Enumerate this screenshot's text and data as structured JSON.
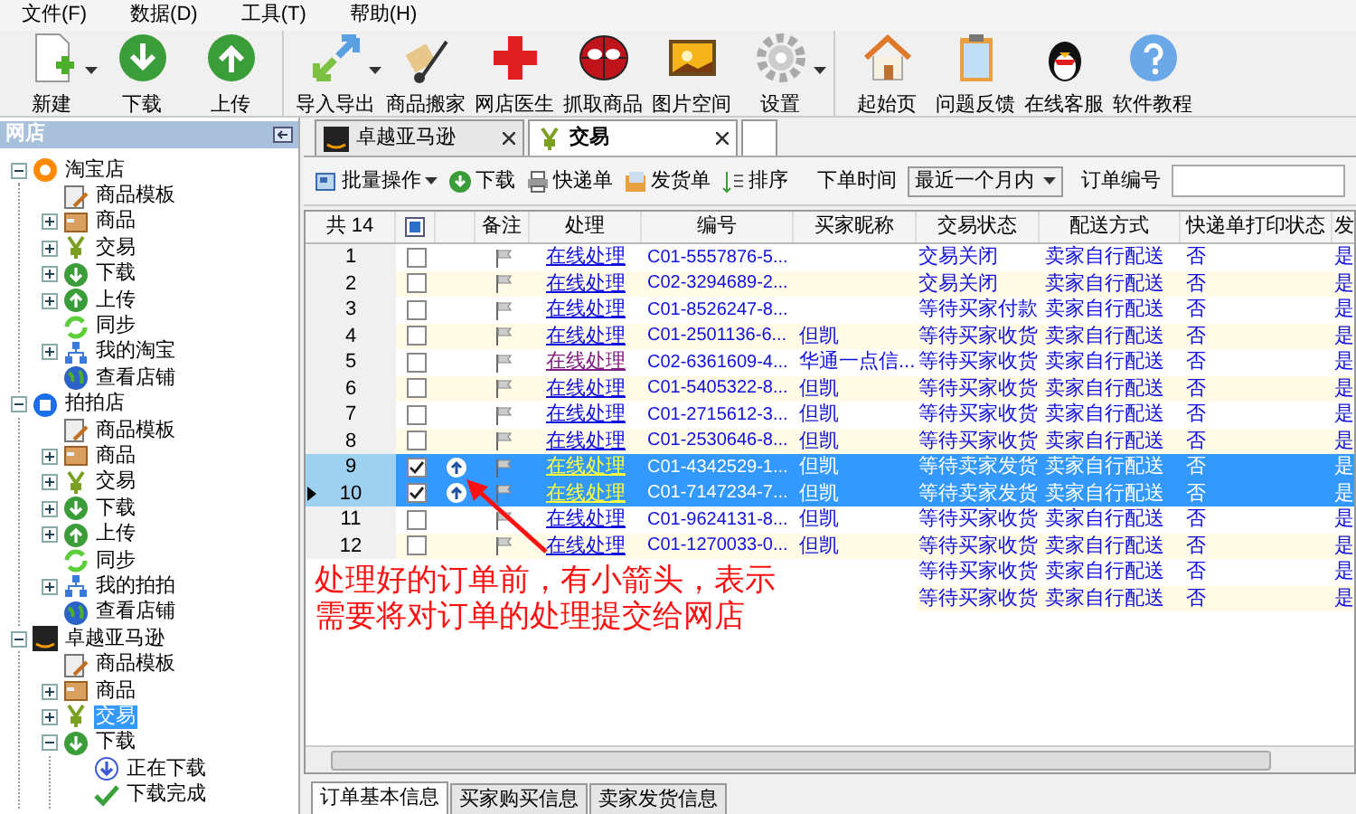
{
  "menu": [
    "文件(F)",
    "数据(D)",
    "工具(T)",
    "帮助(H)"
  ],
  "toolbar": [
    [
      {
        "label": "新建",
        "dropdown": true
      },
      {
        "label": "下载",
        "dropdown": false
      },
      {
        "label": "上传",
        "dropdown": false
      }
    ],
    [
      {
        "label": "导入导出",
        "dropdown": true
      },
      {
        "label": "商品搬家",
        "dropdown": false
      },
      {
        "label": "网店医生",
        "dropdown": false
      },
      {
        "label": "抓取商品",
        "dropdown": false
      },
      {
        "label": "图片空间",
        "dropdown": false
      },
      {
        "label": "设置",
        "dropdown": true
      }
    ],
    [
      {
        "label": "起始页",
        "dropdown": false
      },
      {
        "label": "问题反馈",
        "dropdown": false
      },
      {
        "label": "在线客服",
        "dropdown": false
      },
      {
        "label": "软件教程",
        "dropdown": false
      }
    ]
  ],
  "sidebar": {
    "title": "网店",
    "tree": [
      {
        "label": "淘宝店",
        "kind": "taobao",
        "expanded": true,
        "selected": false,
        "children": [
          {
            "label": "商品模板",
            "kind": "template",
            "selected": false
          },
          {
            "label": "商品",
            "kind": "goods",
            "expanded": false,
            "selected": false
          },
          {
            "label": "交易",
            "kind": "trade",
            "expanded": false,
            "selected": false
          },
          {
            "label": "下载",
            "kind": "download",
            "expanded": false,
            "selected": false
          },
          {
            "label": "上传",
            "kind": "upload",
            "expanded": false,
            "selected": false
          },
          {
            "label": "同步",
            "kind": "sync",
            "selected": false
          },
          {
            "label": "我的淘宝",
            "kind": "network",
            "expanded": false,
            "selected": false
          },
          {
            "label": "查看店铺",
            "kind": "globe",
            "selected": false
          }
        ]
      },
      {
        "label": "拍拍店",
        "kind": "paipai",
        "expanded": true,
        "selected": false,
        "children": [
          {
            "label": "商品模板",
            "kind": "template",
            "selected": false
          },
          {
            "label": "商品",
            "kind": "goods",
            "expanded": false,
            "selected": false
          },
          {
            "label": "交易",
            "kind": "trade",
            "expanded": false,
            "selected": false
          },
          {
            "label": "下载",
            "kind": "download",
            "expanded": false,
            "selected": false
          },
          {
            "label": "上传",
            "kind": "upload",
            "expanded": false,
            "selected": false
          },
          {
            "label": "同步",
            "kind": "sync",
            "selected": false
          },
          {
            "label": "我的拍拍",
            "kind": "network",
            "expanded": false,
            "selected": false
          },
          {
            "label": "查看店铺",
            "kind": "globe",
            "selected": false
          }
        ]
      },
      {
        "label": "卓越亚马逊",
        "kind": "amazon",
        "expanded": true,
        "selected": false,
        "children": [
          {
            "label": "商品模板",
            "kind": "template",
            "selected": false
          },
          {
            "label": "商品",
            "kind": "goods",
            "expanded": false,
            "selected": false
          },
          {
            "label": "交易",
            "kind": "trade",
            "expanded": false,
            "selected": true
          },
          {
            "label": "下载",
            "kind": "download",
            "expanded": true,
            "selected": false,
            "children": [
              {
                "label": "正在下载",
                "kind": "downloading",
                "selected": false
              },
              {
                "label": "下载完成",
                "kind": "done",
                "selected": false
              }
            ]
          }
        ]
      }
    ]
  },
  "tabs": [
    {
      "label": "卓越亚马逊",
      "selected": false
    },
    {
      "label": "交易",
      "selected": true
    }
  ],
  "filter_bar": {
    "buttons": [
      {
        "label": "批量操作",
        "dropdown": true
      },
      {
        "label": "下载",
        "dropdown": false
      },
      {
        "label": "快递单",
        "dropdown": false
      },
      {
        "label": "发货单",
        "dropdown": false
      },
      {
        "label": "排序",
        "dropdown": false
      }
    ],
    "time_label": "下单时间",
    "time_value": "最近一个月内",
    "order_label": "订单编号"
  },
  "table": {
    "count": "共 14",
    "select_all_partial": true,
    "columns": [
      "备注",
      "处理",
      "编号",
      "买家昵称",
      "交易状态",
      "配送方式",
      "快递单打印状态",
      "发"
    ],
    "rows": [
      {
        "number": "1",
        "checked": false,
        "selected": false,
        "current": false,
        "pending_upload": false,
        "visited": false,
        "handle": "在线处理",
        "order_no": "C01-5557876-5...",
        "buyer": "",
        "status": "交易关闭",
        "delivery": "卖家自行配送",
        "printed": "否",
        "column_11": "是"
      },
      {
        "number": "2",
        "checked": false,
        "selected": false,
        "current": false,
        "pending_upload": false,
        "visited": false,
        "handle": "在线处理",
        "order_no": "C02-3294689-2...",
        "buyer": "",
        "status": "交易关闭",
        "delivery": "卖家自行配送",
        "printed": "否",
        "column_11": "是"
      },
      {
        "number": "3",
        "checked": false,
        "selected": false,
        "current": false,
        "pending_upload": false,
        "visited": false,
        "handle": "在线处理",
        "order_no": "C01-8526247-8...",
        "buyer": "",
        "status": "等待买家付款",
        "delivery": "卖家自行配送",
        "printed": "否",
        "column_11": "是"
      },
      {
        "number": "4",
        "checked": false,
        "selected": false,
        "current": false,
        "pending_upload": false,
        "visited": false,
        "handle": "在线处理",
        "order_no": "C01-2501136-6...",
        "buyer": "但凯",
        "status": "等待买家收货",
        "delivery": "卖家自行配送",
        "printed": "否",
        "column_11": "是"
      },
      {
        "number": "5",
        "checked": false,
        "selected": false,
        "current": false,
        "pending_upload": false,
        "visited": true,
        "handle": "在线处理",
        "order_no": "C02-6361609-4...",
        "buyer": "华通一点信...",
        "status": "等待买家收货",
        "delivery": "卖家自行配送",
        "printed": "否",
        "column_11": "是"
      },
      {
        "number": "6",
        "checked": false,
        "selected": false,
        "current": false,
        "pending_upload": false,
        "visited": false,
        "handle": "在线处理",
        "order_no": "C01-5405322-8...",
        "buyer": "但凯",
        "status": "等待买家收货",
        "delivery": "卖家自行配送",
        "printed": "否",
        "column_11": "是"
      },
      {
        "number": "7",
        "checked": false,
        "selected": false,
        "current": false,
        "pending_upload": false,
        "visited": false,
        "handle": "在线处理",
        "order_no": "C01-2715612-3...",
        "buyer": "但凯",
        "status": "等待买家收货",
        "delivery": "卖家自行配送",
        "printed": "否",
        "column_11": "是"
      },
      {
        "number": "8",
        "checked": false,
        "selected": false,
        "current": false,
        "pending_upload": false,
        "visited": false,
        "handle": "在线处理",
        "order_no": "C01-2530646-8...",
        "buyer": "但凯",
        "status": "等待买家收货",
        "delivery": "卖家自行配送",
        "printed": "否",
        "column_11": "是"
      },
      {
        "number": "9",
        "checked": true,
        "selected": true,
        "current": false,
        "pending_upload": true,
        "visited": false,
        "handle": "在线处理",
        "order_no": "C01-4342529-1...",
        "buyer": "但凯",
        "status": "等待卖家发货",
        "delivery": "卖家自行配送",
        "printed": "否",
        "column_11": "是"
      },
      {
        "number": "10",
        "checked": true,
        "selected": true,
        "current": true,
        "pending_upload": true,
        "visited": false,
        "handle": "在线处理",
        "order_no": "C01-7147234-7...",
        "buyer": "但凯",
        "status": "等待卖家发货",
        "delivery": "卖家自行配送",
        "printed": "否",
        "column_11": "是"
      },
      {
        "number": "11",
        "checked": false,
        "selected": false,
        "current": false,
        "pending_upload": false,
        "visited": false,
        "handle": "在线处理",
        "order_no": "C01-9624131-8...",
        "buyer": "但凯",
        "status": "等待买家收货",
        "delivery": "卖家自行配送",
        "printed": "否",
        "column_11": "是"
      },
      {
        "number": "12",
        "checked": false,
        "selected": false,
        "current": false,
        "pending_upload": false,
        "visited": false,
        "handle": "在线处理",
        "order_no": "C01-1270033-0...",
        "buyer": "但凯",
        "status": "等待买家收货",
        "delivery": "卖家自行配送",
        "printed": "否",
        "column_11": "是"
      },
      {
        "status": "等待买家收货",
        "delivery": "卖家自行配送",
        "printed": "否",
        "column_11": "是"
      },
      {
        "status": "等待买家收货",
        "delivery": "卖家自行配送",
        "printed": "否",
        "column_11": "是"
      }
    ]
  },
  "annotation": [
    "处理好的订单前，有小箭头，表示",
    "需要将对订单的处理提交给网店"
  ],
  "bottom_tabs": [
    {
      "label": "订单基本信息",
      "selected": true
    },
    {
      "label": "买家购买信息",
      "selected": false
    },
    {
      "label": "卖家发货信息",
      "selected": false
    }
  ]
}
